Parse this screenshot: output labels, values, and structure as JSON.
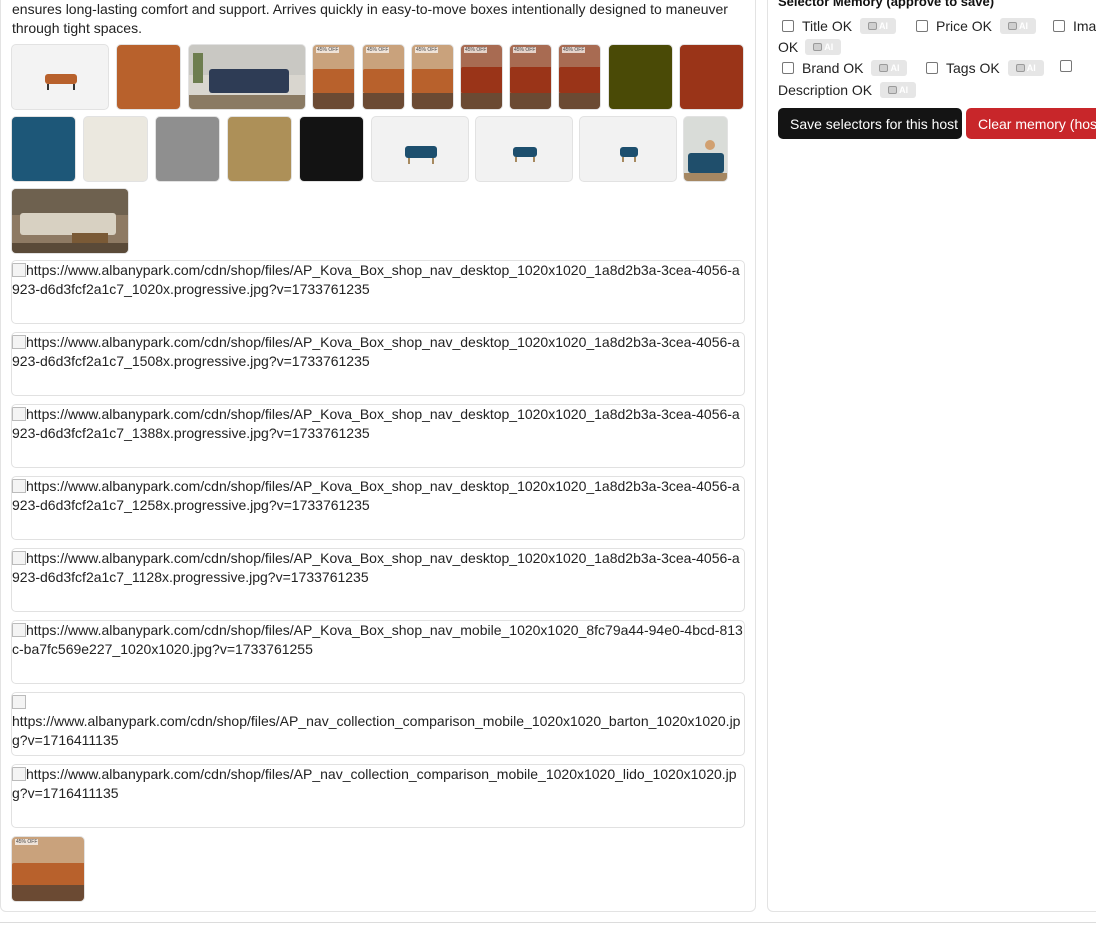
{
  "left": {
    "description": "ensures long-lasting comfort and support. Arrives quickly in easy-to-move boxes intentionally designed to maneuver through tight spaces.",
    "thumb_badge": "45% OFF",
    "broken_images": [
      "https://www.albanypark.com/cdn/shop/files/AP_Kova_Box_shop_nav_desktop_1020x1020_1a8d2b3a-3cea-4056-a923-d6d3fcf2a1c7_1020x.progressive.jpg?v=1733761235",
      "https://www.albanypark.com/cdn/shop/files/AP_Kova_Box_shop_nav_desktop_1020x1020_1a8d2b3a-3cea-4056-a923-d6d3fcf2a1c7_1508x.progressive.jpg?v=1733761235",
      "https://www.albanypark.com/cdn/shop/files/AP_Kova_Box_shop_nav_desktop_1020x1020_1a8d2b3a-3cea-4056-a923-d6d3fcf2a1c7_1388x.progressive.jpg?v=1733761235",
      "https://www.albanypark.com/cdn/shop/files/AP_Kova_Box_shop_nav_desktop_1020x1020_1a8d2b3a-3cea-4056-a923-d6d3fcf2a1c7_1258x.progressive.jpg?v=1733761235",
      "https://www.albanypark.com/cdn/shop/files/AP_Kova_Box_shop_nav_desktop_1020x1020_1a8d2b3a-3cea-4056-a923-d6d3fcf2a1c7_1128x.progressive.jpg?v=1733761235",
      "https://www.albanypark.com/cdn/shop/files/AP_Kova_Box_shop_nav_mobile_1020x1020_8fc79a44-94e0-4bcd-813c-ba7fc569e227_1020x1020.jpg?v=1733761255",
      "https://www.albanypark.com/cdn/shop/files/AP_nav_collection_comparison_mobile_1020x1020_barton_1020x1020.jpg?v=1716411135",
      "https://www.albanypark.com/cdn/shop/files/AP_nav_collection_comparison_mobile_1020x1020_lido_1020x1020.jpg?v=1716411135"
    ]
  },
  "right": {
    "title": "Selector Memory (approve to save)",
    "checks": {
      "title": "Title OK",
      "price": "Price OK",
      "image_a": "Ima",
      "image_b": "OK",
      "brand": "Brand OK",
      "tags": "Tags OK",
      "description": "Description OK"
    },
    "ai_label": "AI",
    "save_button": "Save selectors for this host",
    "clear_button": "Clear memory (host)"
  },
  "colors": {
    "cognac": "#b8612c",
    "rust": "#9a3418",
    "olive": "#4a4a06",
    "navy": "#1d5778",
    "save_bg": "#141414",
    "clear_bg": "#c8262a"
  },
  "icons": [
    "robot-icon",
    "broken-image-icon",
    "checkbox-icon"
  ]
}
